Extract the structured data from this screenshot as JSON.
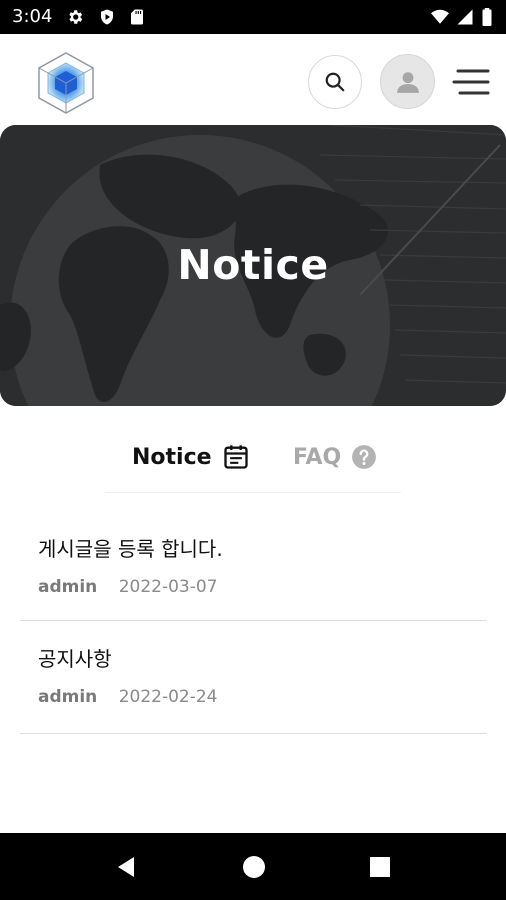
{
  "status_bar": {
    "time": "3:04",
    "left_icons": [
      "gear-icon",
      "shield-play-icon",
      "sd-card-icon"
    ],
    "right_icons": [
      "wifi-icon",
      "signal-icon",
      "battery-icon"
    ]
  },
  "header": {
    "logo": "cube-logo",
    "search_icon": "search-icon",
    "user_icon": "user-icon",
    "menu_icon": "menu-icon"
  },
  "hero": {
    "title": "Notice"
  },
  "tabs": [
    {
      "label": "Notice",
      "icon": "calendar-icon",
      "active": true
    },
    {
      "label": "FAQ",
      "icon": "question-icon",
      "active": false
    }
  ],
  "posts": [
    {
      "title": "게시글을 등록 합니다.",
      "author": "admin",
      "date": "2022-03-07"
    },
    {
      "title": "공지사항",
      "author": "admin",
      "date": "2022-02-24"
    }
  ],
  "nav_bar": [
    "back-icon",
    "home-icon",
    "recents-icon"
  ],
  "colors": {
    "status_bar": "#000000",
    "hero_bg": "#2e2f31",
    "active_tab": "#111111",
    "inactive_tab": "#a9a9a9",
    "meta_text": "#8a8a8a",
    "logo_blue": "#1f5fd6"
  }
}
